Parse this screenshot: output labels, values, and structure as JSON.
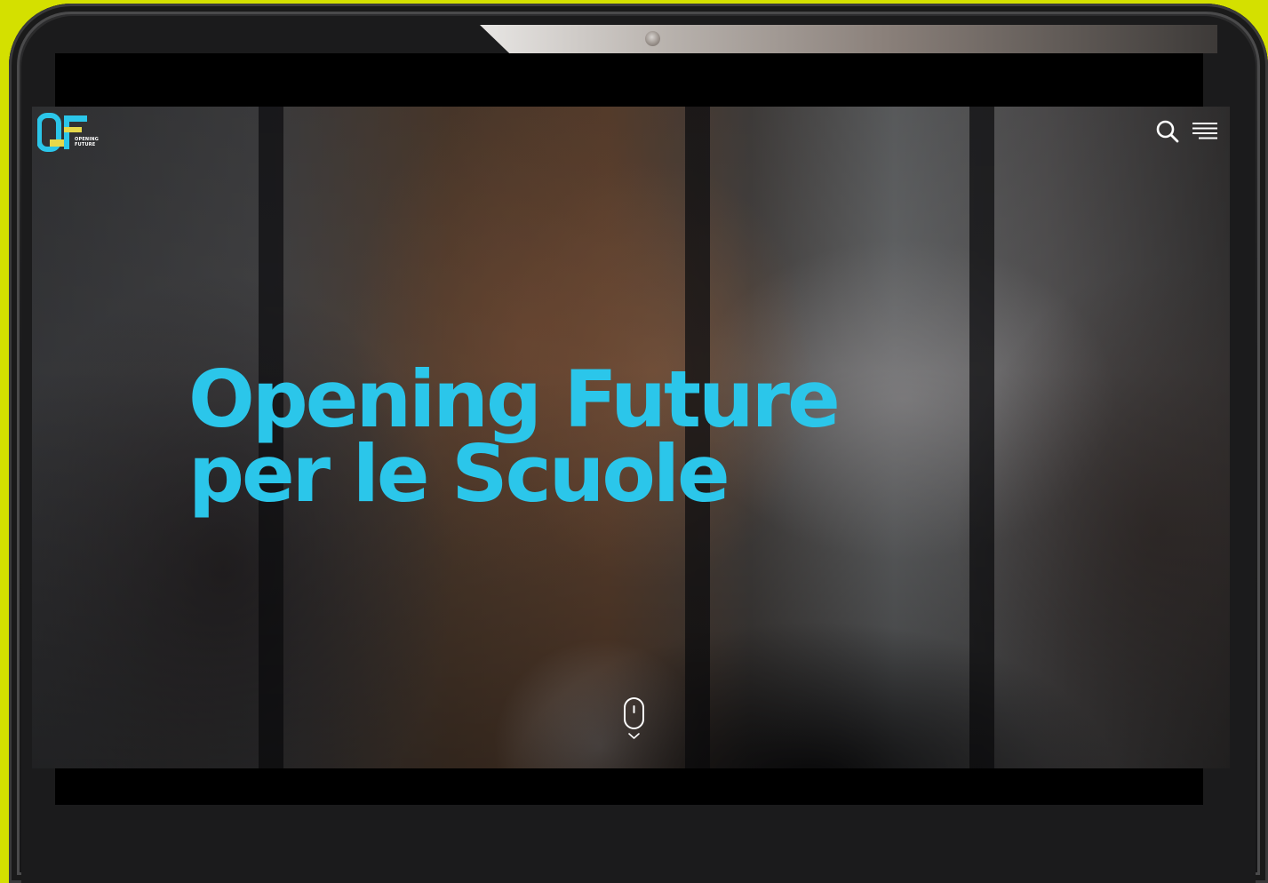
{
  "site": {
    "logo_alt": "OF",
    "logo_small_line1": "OPENING",
    "logo_small_line2": "FUTURE"
  },
  "header": {
    "search_icon": "search-icon",
    "menu_icon": "hamburger-menu-icon"
  },
  "hero": {
    "title_line1": "Opening Future",
    "title_line2": "per le Scuole",
    "scroll_icon": "mouse-scroll-icon"
  },
  "colors": {
    "accent": "#2bc6ea",
    "logo_yellow": "#e6d84a",
    "background": "#d4e000",
    "tablet_frame": "#1c1c1d"
  }
}
